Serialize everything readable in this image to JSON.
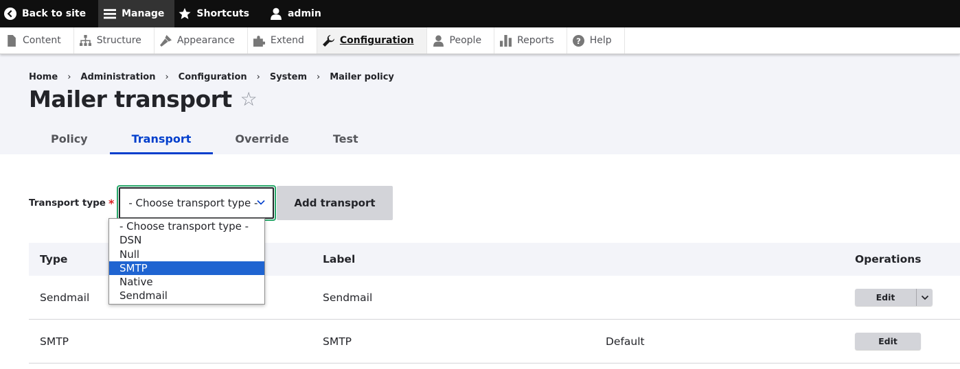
{
  "toolbar": {
    "back": "Back to site",
    "manage": "Manage",
    "shortcuts": "Shortcuts",
    "user": "admin"
  },
  "tray": [
    {
      "label": "Content",
      "icon": "content-icon"
    },
    {
      "label": "Structure",
      "icon": "structure-icon"
    },
    {
      "label": "Appearance",
      "icon": "appearance-icon"
    },
    {
      "label": "Extend",
      "icon": "extend-icon"
    },
    {
      "label": "Configuration",
      "icon": "configuration-icon"
    },
    {
      "label": "People",
      "icon": "people-icon"
    },
    {
      "label": "Reports",
      "icon": "reports-icon"
    },
    {
      "label": "Help",
      "icon": "help-icon"
    }
  ],
  "breadcrumb": [
    "Home",
    "Administration",
    "Configuration",
    "System",
    "Mailer policy"
  ],
  "page_title": "Mailer transport",
  "tabs": [
    "Policy",
    "Transport",
    "Override",
    "Test"
  ],
  "active_tab": "Transport",
  "form": {
    "label": "Transport type",
    "required_mark": "*",
    "selected_value": "- Choose transport type -",
    "add_button": "Add transport",
    "options": [
      "- Choose transport type -",
      "DSN",
      "Null",
      "SMTP",
      "Native",
      "Sendmail"
    ],
    "highlighted_option": "SMTP"
  },
  "table": {
    "headers": [
      "Type",
      "Label",
      "",
      "Operations"
    ],
    "rows": [
      {
        "type": "Sendmail",
        "label": "Sendmail",
        "default": "",
        "op": "Edit"
      },
      {
        "type": "SMTP",
        "label": "SMTP",
        "default": "Default",
        "op": "Edit"
      }
    ]
  },
  "colors": {
    "accent": "#003ecc",
    "focus_ring": "#26a769",
    "selected_option": "#1f64d1",
    "required": "#d72222"
  }
}
